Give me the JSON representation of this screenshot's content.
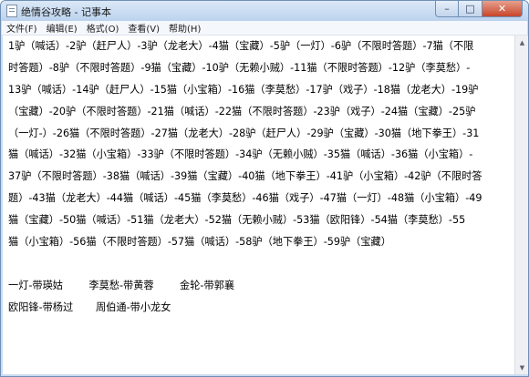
{
  "window": {
    "title": "绝情谷攻略 - 记事本",
    "minimize_icon": "minimize-icon",
    "maximize_icon": "maximize-icon",
    "close_icon": "close-icon"
  },
  "caption": {
    "minimize": "–",
    "maximize": "□",
    "close": "✕"
  },
  "menu": [
    {
      "label": "文件(F)"
    },
    {
      "label": "编辑(E)"
    },
    {
      "label": "格式(O)"
    },
    {
      "label": "查看(V)"
    },
    {
      "label": "帮助(H)"
    }
  ],
  "content": {
    "lines": [
      "1驴（喊话）-2驴（赶尸人）-3驴（龙老大）-4猫（宝藏）-5驴（一灯）-6驴（不限时答题）-7猫（不限",
      "时答题）-8驴（不限时答题）-9猫（宝藏）-10驴（无赖小贼）-11猫（不限时答题）-12驴（李莫愁）-",
      "13驴（喊话）-14驴（赶尸人）-15猫（小宝箱）-16猫（李莫愁）-17驴（戏子）-18猫（龙老大）-19驴",
      "（宝藏）-20驴（不限时答题）-21猫（喊话）-22猫（不限时答题）-23驴（戏子）-24猫（宝藏）-25驴",
      "（一灯-）-26猫（不限时答题）-27猫（龙老大）-28驴（赶尸人）-29驴（宝藏）-30猫（地下拳王）-31",
      "猫（喊话）-32猫（小宝箱）-33驴（不限时答题）-34驴（无赖小贼）-35猫（喊话）-36猫（小宝箱）-",
      "37驴（不限时答题）-38猫（喊话）-39猫（宝藏）-40猫（地下拳王）-41驴（小宝箱）-42驴（不限时答",
      "题）-43猫（龙老大）-44猫（喊话）-45猫（李莫愁）-46猫（戏子）-47猫（一灯）-48猫（小宝箱）-49",
      "猫（宝藏）-50猫（喊话）-51猫（龙老大）-52猫（无赖小贼）-53猫（欧阳锋）-54猫（李莫愁）-55",
      "猫（小宝箱）-56猫（不限时答题）-57猫（喊话）-58驴（地下拳王）-59驴（宝藏）",
      "",
      "一灯-带瑛姑        李莫愁-带黄蓉        金轮-带郭襄",
      "欧阳锋-带杨过       周伯通-带小龙女"
    ]
  },
  "scrollbar": {
    "up_icon": "scroll-up-arrow-icon",
    "down_icon": "scroll-down-arrow-icon",
    "up": "▲",
    "down": "▼"
  }
}
